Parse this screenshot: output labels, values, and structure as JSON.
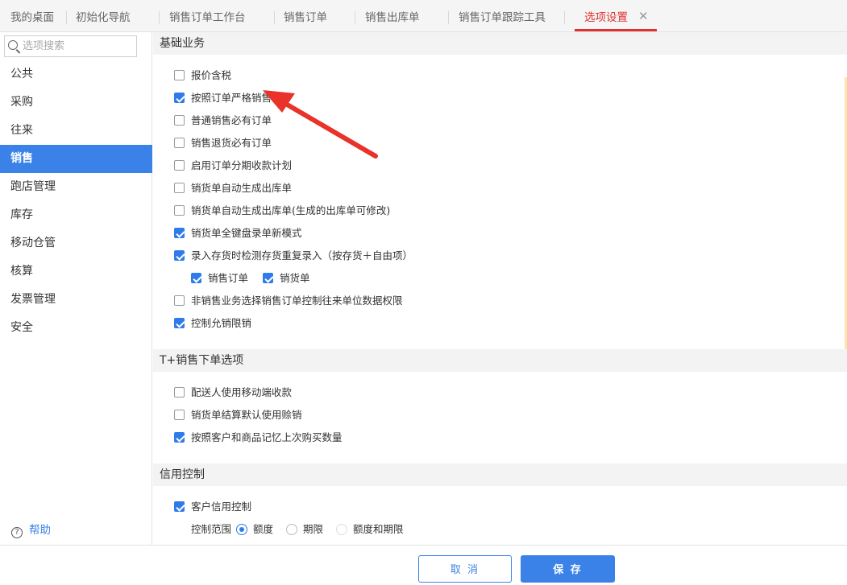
{
  "tabs": [
    {
      "label": "我的桌面"
    },
    {
      "label": "初始化导航"
    },
    {
      "label": "销售订单工作台"
    },
    {
      "label": "销售订单"
    },
    {
      "label": "销售出库单"
    },
    {
      "label": "销售订单跟踪工具"
    },
    {
      "label": "选项设置",
      "active": true
    }
  ],
  "search": {
    "placeholder": "选项搜索"
  },
  "sidebar": {
    "items": [
      {
        "label": "公共"
      },
      {
        "label": "采购"
      },
      {
        "label": "往来"
      },
      {
        "label": "销售",
        "active": true
      },
      {
        "label": "跑店管理"
      },
      {
        "label": "库存"
      },
      {
        "label": "移动仓管"
      },
      {
        "label": "核算"
      },
      {
        "label": "发票管理"
      },
      {
        "label": "安全"
      }
    ],
    "help_label": "帮助"
  },
  "sections": {
    "basic": {
      "title": "基础业务",
      "options": [
        {
          "label": "报价含税",
          "checked": false
        },
        {
          "label": "按照订单严格销售",
          "checked": true
        },
        {
          "label": "普通销售必有订单",
          "checked": false
        },
        {
          "label": "销售退货必有订单",
          "checked": false
        },
        {
          "label": "启用订单分期收款计划",
          "checked": false
        },
        {
          "label": "销货单自动生成出库单",
          "checked": false
        },
        {
          "label": "销货单自动生成出库单(生成的出库单可修改)",
          "checked": false
        },
        {
          "label": "销货单全键盘录单新模式",
          "checked": true
        },
        {
          "label": "录入存货时检测存货重复录入（按存货＋自由项）",
          "checked": true
        }
      ],
      "sub_options": [
        {
          "label": "销售订单",
          "checked": true
        },
        {
          "label": "销货单",
          "checked": true
        }
      ],
      "options_after": [
        {
          "label": "非销售业务选择销售订单控制往来单位数据权限",
          "checked": false
        },
        {
          "label": "控制允销限销",
          "checked": true
        }
      ]
    },
    "tplus": {
      "title": "T+销售下单选项",
      "options": [
        {
          "label": "配送人使用移动端收款",
          "checked": false
        },
        {
          "label": "销货单结算默认使用赊销",
          "checked": false
        },
        {
          "label": "按照客户和商品记忆上次购买数量",
          "checked": true
        }
      ]
    },
    "credit": {
      "title": "信用控制",
      "options": [
        {
          "label": "客户信用控制",
          "checked": true
        }
      ],
      "range_label": "控制范围",
      "radios": [
        {
          "label": "额度",
          "selected": true
        },
        {
          "label": "期限",
          "selected": false
        },
        {
          "label": "额度和期限",
          "selected": false,
          "disabled": true
        }
      ]
    }
  },
  "footer": {
    "cancel_label": "取 消",
    "save_label": "保 存"
  },
  "colors": {
    "accent": "#3a82e8",
    "active_tab": "#e03030",
    "annotation_arrow": "#e8322a"
  }
}
